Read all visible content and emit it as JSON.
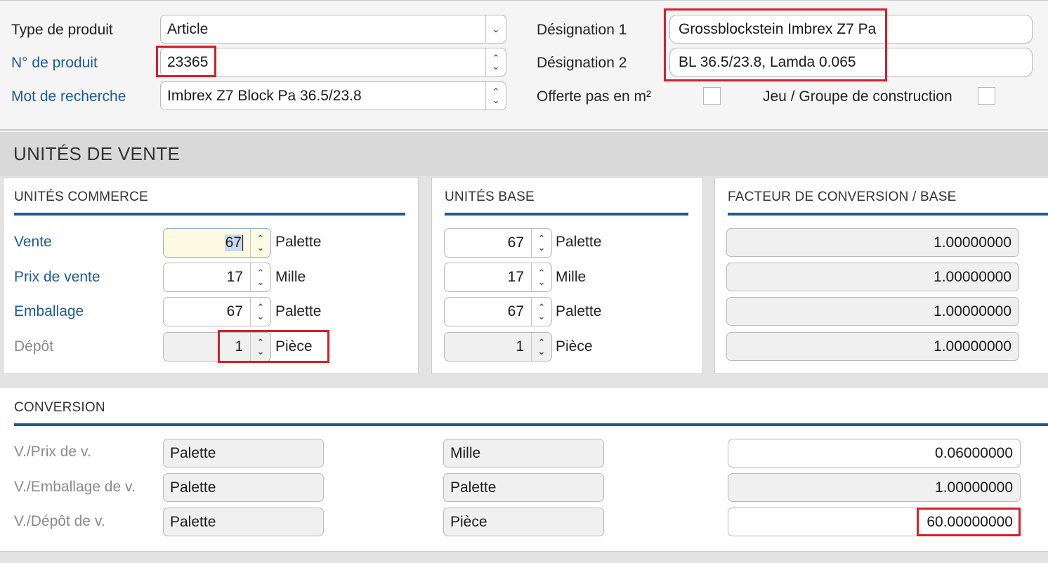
{
  "header": {
    "product_type": {
      "label": "Type de produit",
      "value": "Article"
    },
    "product_no": {
      "label": "N° de produit",
      "value": "23365"
    },
    "search_word": {
      "label": "Mot de recherche",
      "value": "Imbrex Z7 Block Pa 36.5/23.8"
    },
    "designation1": {
      "label": "Désignation 1",
      "value": "Grossblockstein Imbrex Z7 Pa"
    },
    "designation2": {
      "label": "Désignation 2",
      "value": "BL 36.5/23.8, Lamda 0.065"
    },
    "offered_not_m2": {
      "label": "Offerte pas en m²",
      "checked": false
    },
    "construction_group": {
      "label": "Jeu / Groupe de construction",
      "checked": false
    }
  },
  "sales_units": {
    "section_title": "UNITÉS DE VENTE",
    "commerce_title": "UNITÉS COMMERCE",
    "base_title": "UNITÉS BASE",
    "factor_title": "FACTEUR DE CONVERSION / BASE",
    "rows": [
      {
        "label": "Vente",
        "commerce_value": "67",
        "commerce_unit": "Palette",
        "base_value": "67",
        "base_unit": "Palette",
        "factor": "1.00000000"
      },
      {
        "label": "Prix de vente",
        "commerce_value": "17",
        "commerce_unit": "Mille",
        "base_value": "17",
        "base_unit": "Mille",
        "factor": "1.00000000"
      },
      {
        "label": "Emballage",
        "commerce_value": "67",
        "commerce_unit": "Palette",
        "base_value": "67",
        "base_unit": "Palette",
        "factor": "1.00000000"
      },
      {
        "label": "Dépôt",
        "commerce_value": "1",
        "commerce_unit": "Pièce",
        "base_value": "1",
        "base_unit": "Pièce",
        "factor": "1.00000000"
      }
    ]
  },
  "conversion": {
    "title": "CONVERSION",
    "rows": [
      {
        "label": "V./Prix de v.",
        "from": "Palette",
        "to": "Mille",
        "factor": "0.06000000"
      },
      {
        "label": "V./Emballage de v.",
        "from": "Palette",
        "to": "Palette",
        "factor": "1.00000000"
      },
      {
        "label": "V./Dépôt de v.",
        "from": "Palette",
        "to": "Pièce",
        "factor": "60.00000000"
      }
    ]
  },
  "icons": {
    "spin_up": "⌃",
    "spin_down": "⌄",
    "dropdown": "⌄"
  },
  "colors": {
    "accent": "#1a5a99",
    "highlight": "#d3202a",
    "link_label": "#1d5a96"
  }
}
